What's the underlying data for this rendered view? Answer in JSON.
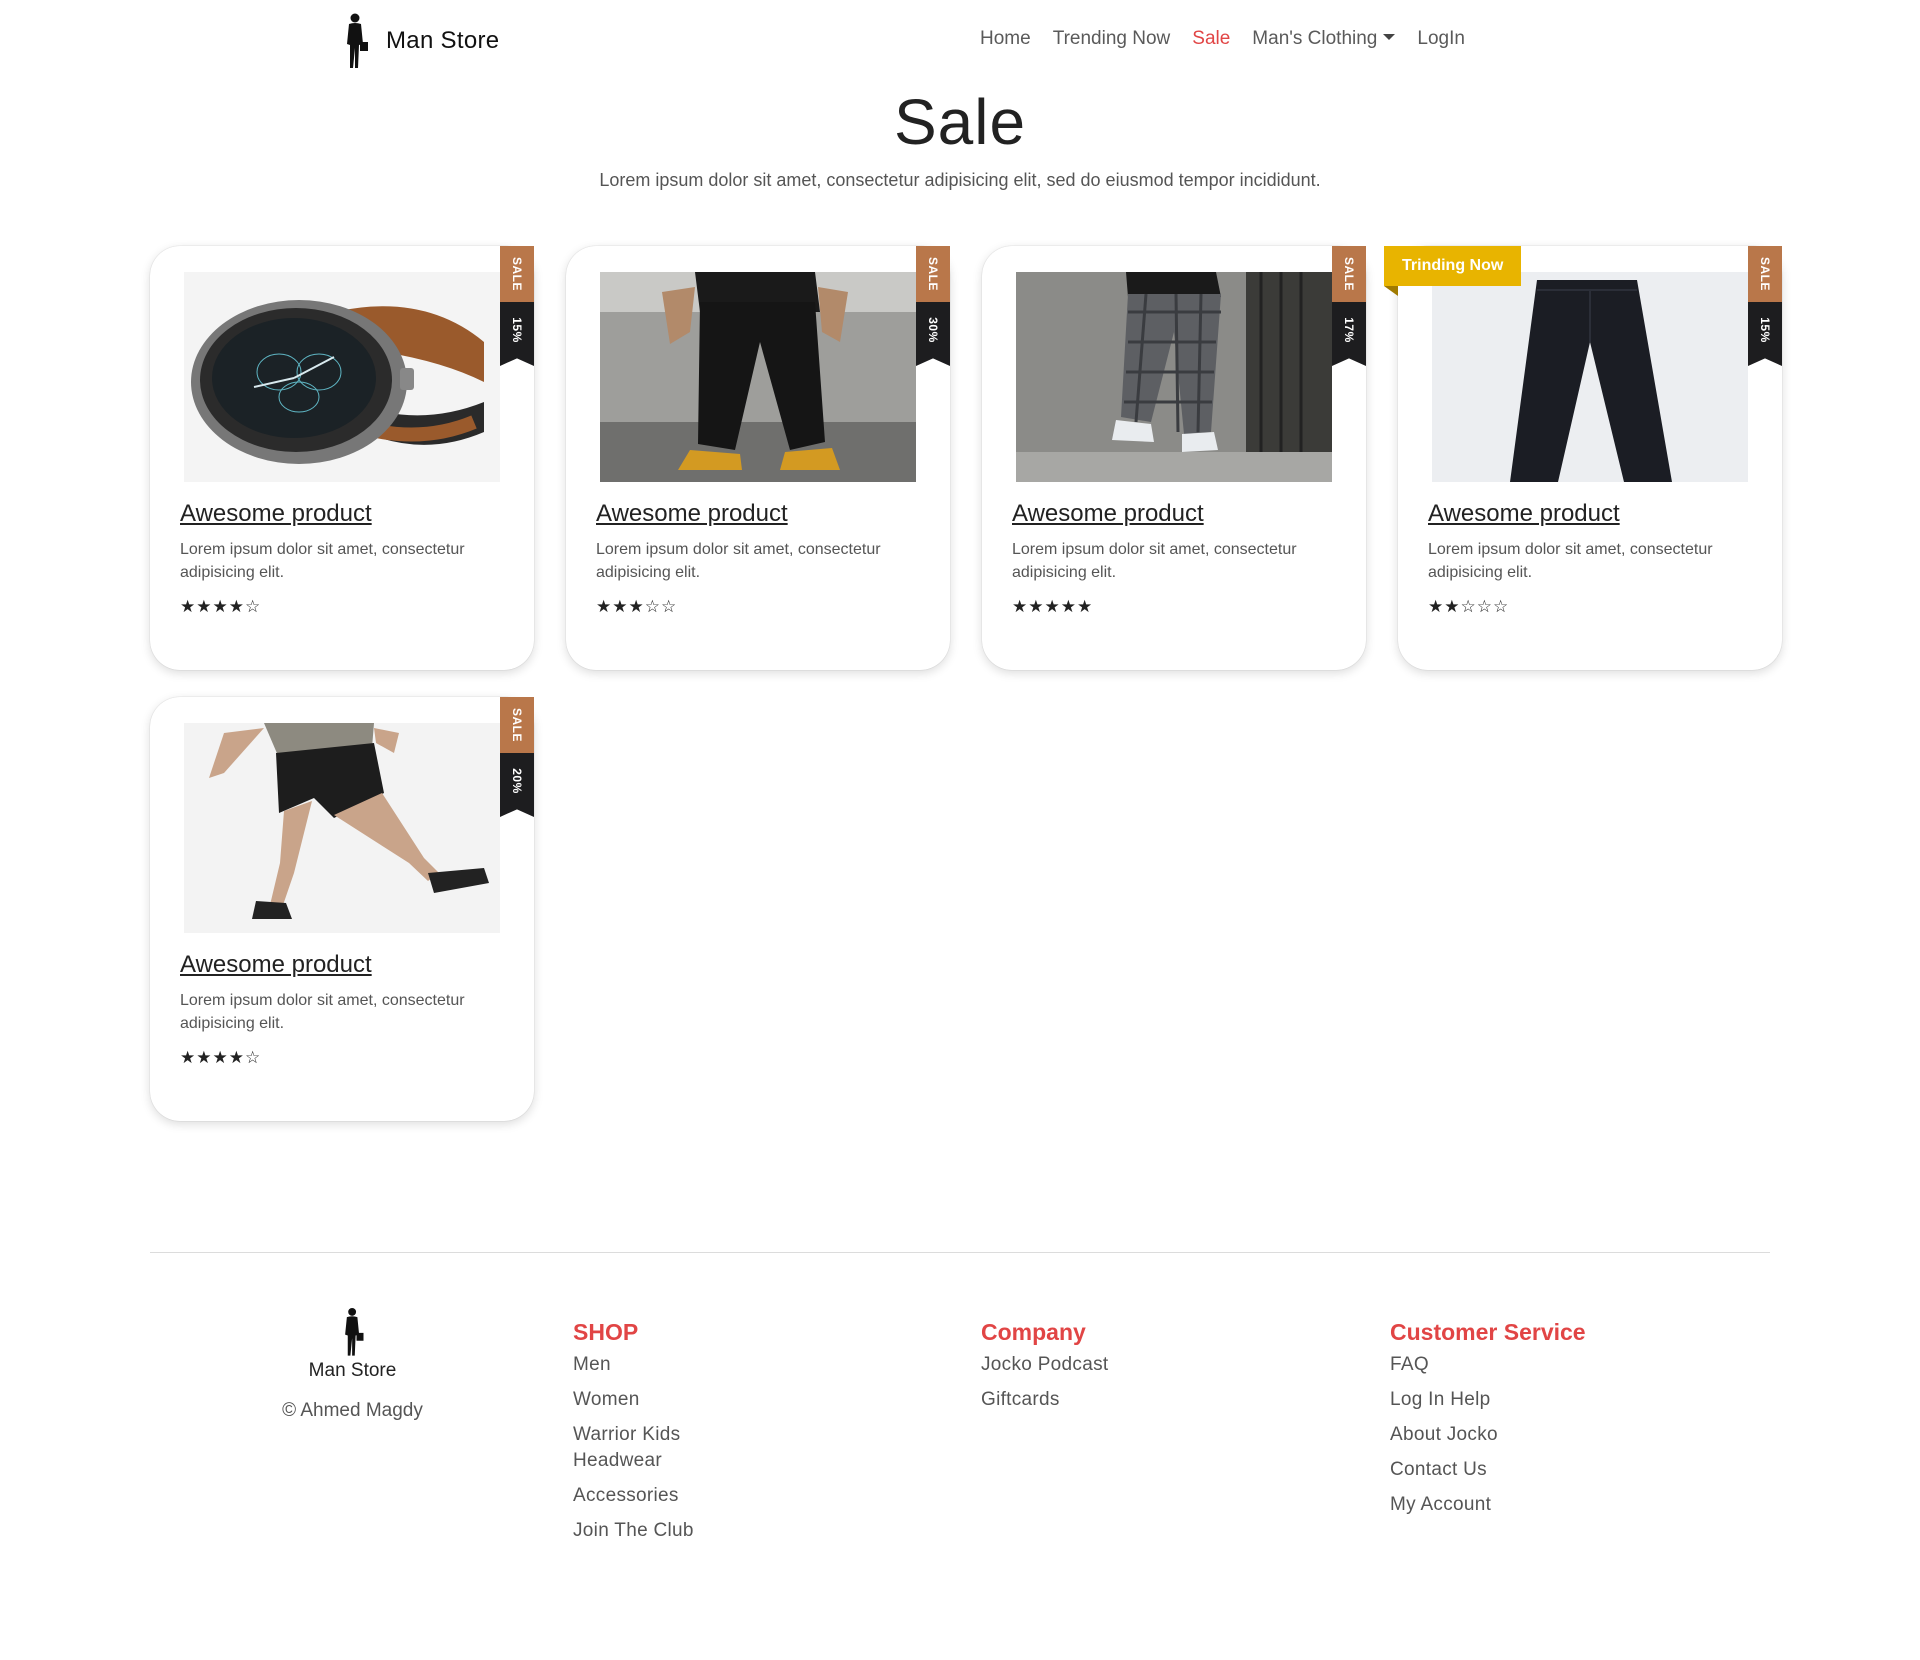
{
  "brand": {
    "name": "Man Store",
    "logo_icon": "man-silhouette-icon"
  },
  "nav": {
    "items": [
      {
        "label": "Home",
        "active": false
      },
      {
        "label": "Trending Now",
        "active": false
      },
      {
        "label": "Sale",
        "active": true
      },
      {
        "label": "Man's Clothing",
        "active": false,
        "dropdown": true
      },
      {
        "label": "LogIn",
        "active": false
      }
    ]
  },
  "header": {
    "title": "Sale",
    "subtitle": "Lorem ipsum dolor sit amet, consectetur adipisicing elit, sed do eiusmod tempor incididunt."
  },
  "products": [
    {
      "title": "Awesome product",
      "description": "Lorem ipsum dolor sit amet, consectetur adipisicing elit.",
      "rating": 4,
      "max_rating": 5,
      "sale_label": "SALE",
      "discount": "15%",
      "image": "smartwatch"
    },
    {
      "title": "Awesome product",
      "description": "Lorem ipsum dolor sit amet, consectetur adipisicing elit.",
      "rating": 3,
      "max_rating": 5,
      "sale_label": "SALE",
      "discount": "30%",
      "image": "black-cargo-pants"
    },
    {
      "title": "Awesome product",
      "description": "Lorem ipsum dolor sit amet, consectetur adipisicing elit.",
      "rating": 5,
      "max_rating": 5,
      "sale_label": "SALE",
      "discount": "17%",
      "image": "plaid-trousers"
    },
    {
      "title": "Awesome product",
      "description": "Lorem ipsum dolor sit amet, consectetur adipisicing elit.",
      "rating": 2,
      "max_rating": 5,
      "sale_label": "SALE",
      "discount": "15%",
      "badge": "Trinding Now",
      "image": "navy-pants"
    },
    {
      "title": "Awesome product",
      "description": "Lorem ipsum dolor sit amet, consectetur adipisicing elit.",
      "rating": 4,
      "max_rating": 5,
      "sale_label": "SALE",
      "discount": "20%",
      "image": "black-shorts"
    }
  ],
  "footer": {
    "brand_name": "Man Store",
    "copyright": "© Ahmed Magdy",
    "columns": [
      {
        "heading": "SHOP",
        "links": [
          "Men",
          "Women",
          "Warrior Kids Headwear",
          "Accessories",
          "Join The Club"
        ]
      },
      {
        "heading": "Company",
        "links": [
          "Jocko Podcast",
          "Giftcards"
        ]
      },
      {
        "heading": "Customer Service",
        "links": [
          "FAQ",
          "Log In Help",
          "About Jocko",
          "Contact Us",
          "My Account"
        ]
      }
    ]
  },
  "colors": {
    "accent": "#e14545",
    "ribbon_sale": "#b9774a",
    "ribbon_discount": "#1d1d1f",
    "badge": "#e8b400"
  }
}
